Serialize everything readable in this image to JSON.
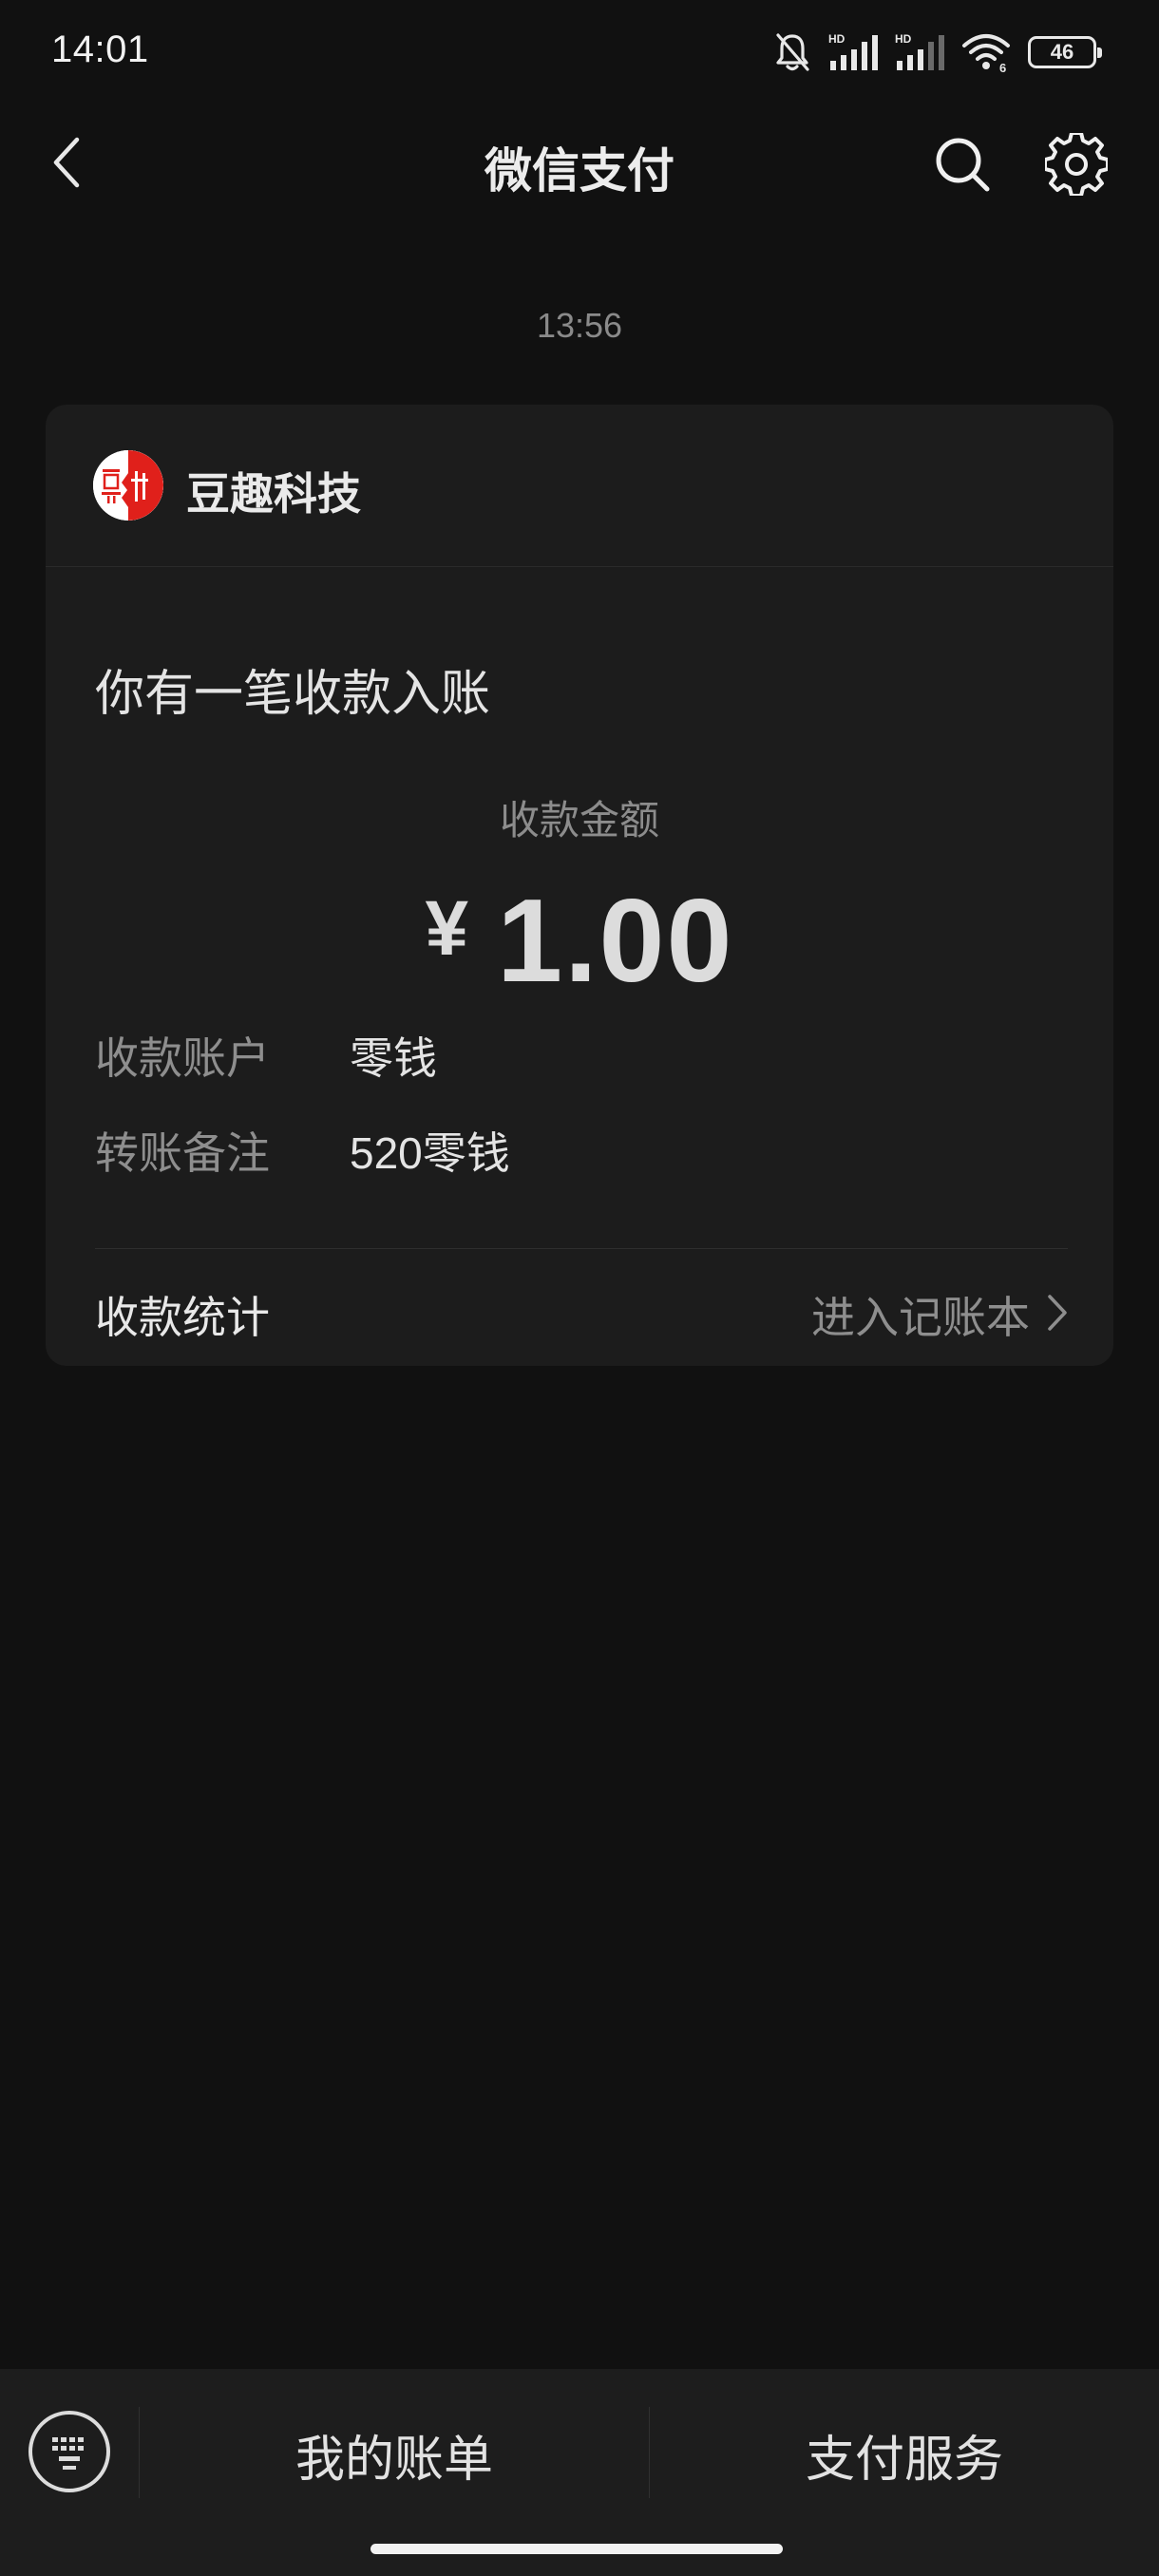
{
  "status_bar": {
    "time": "14:01",
    "battery": "46",
    "icons": [
      "mute-bell-icon",
      "hd-signal-icon",
      "hd-signal-icon",
      "wifi-6-icon",
      "battery-icon"
    ]
  },
  "nav": {
    "title": "微信支付",
    "icons": [
      "back-chevron-icon",
      "search-icon",
      "gear-icon"
    ]
  },
  "message": {
    "time": "13:56",
    "merchant": {
      "name": "豆趣科技",
      "logo_colors": [
        "#e0201b",
        "#ffffff"
      ]
    },
    "subject": "你有一笔收款入账",
    "amount_label": "收款金额",
    "amount_symbol": "¥",
    "amount_value": "1.00",
    "details": [
      {
        "label": "收款账户",
        "value": "零钱"
      },
      {
        "label": "转账备注",
        "value": "520零钱"
      }
    ],
    "footer": {
      "label": "收款统计",
      "link_label": "进入记账本"
    }
  },
  "bottom_menu": {
    "items": [
      "我的账单",
      "支付服务"
    ]
  },
  "colors": {
    "background": "#111111",
    "card": "#1c1c1c",
    "bottom_bar": "#1d1d1d",
    "muted_text": "#8e8e8e",
    "primary_text": "#e4e4e4",
    "logo_red": "#e0201b"
  }
}
